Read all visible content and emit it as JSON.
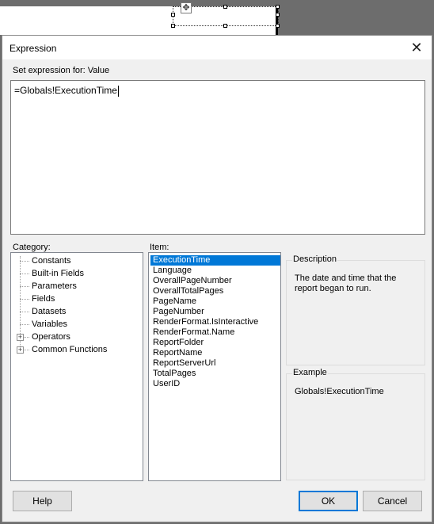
{
  "dialog": {
    "title": "Expression",
    "close_glyph": "✕",
    "set_expression_label": "Set expression for: Value",
    "expression_value": "=Globals!ExecutionTime"
  },
  "category": {
    "label": "Category:",
    "items": [
      {
        "label": "Constants",
        "expandable": false
      },
      {
        "label": "Built-in Fields",
        "expandable": false,
        "selected": true
      },
      {
        "label": "Parameters",
        "expandable": false
      },
      {
        "label": "Fields",
        "expandable": false
      },
      {
        "label": "Datasets",
        "expandable": false
      },
      {
        "label": "Variables",
        "expandable": false
      },
      {
        "label": "Operators",
        "expandable": true
      },
      {
        "label": "Common Functions",
        "expandable": true
      }
    ],
    "expander_glyph": "+"
  },
  "item": {
    "label": "Item:",
    "items": [
      "ExecutionTime",
      "Language",
      "OverallPageNumber",
      "OverallTotalPages",
      "PageName",
      "PageNumber",
      "RenderFormat.IsInteractive",
      "RenderFormat.Name",
      "ReportFolder",
      "ReportName",
      "ReportServerUrl",
      "TotalPages",
      "UserID"
    ],
    "selected": "ExecutionTime"
  },
  "description": {
    "title": "Description",
    "text": "The date and time that the report began to run."
  },
  "example": {
    "title": "Example",
    "text": "Globals!ExecutionTime"
  },
  "buttons": {
    "help": "Help",
    "ok": "OK",
    "cancel": "Cancel"
  },
  "canvas": {
    "move_glyph": "✥"
  }
}
